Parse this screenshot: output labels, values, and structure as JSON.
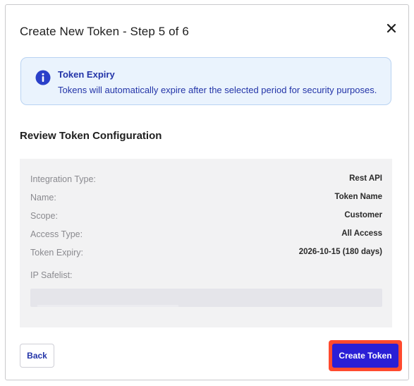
{
  "dialog": {
    "title": "Create New Token - Step 5 of 6",
    "close_icon": "close-icon"
  },
  "banner": {
    "icon": "info-icon",
    "title": "Token Expiry",
    "text": "Tokens will automatically expire after the selected period for security purposes.",
    "background": "#eaf3fd",
    "text_color": "#2334a8"
  },
  "review": {
    "title": "Review Token Configuration",
    "rows": [
      {
        "label": "Integration Type:",
        "value": "Rest API"
      },
      {
        "label": "Name:",
        "value": "Token Name"
      },
      {
        "label": "Scope:",
        "value": "Customer"
      },
      {
        "label": "Access Type:",
        "value": "All Access"
      },
      {
        "label": "Token Expiry:",
        "value": "2026-10-15 (180 days)"
      }
    ],
    "ip_safelist_label": "IP Safelist:",
    "ip_safelist_value": ""
  },
  "footer": {
    "back_label": "Back",
    "create_label": "Create Token",
    "primary_color": "#2a1fd6",
    "highlight_color": "#ff4a2e"
  }
}
